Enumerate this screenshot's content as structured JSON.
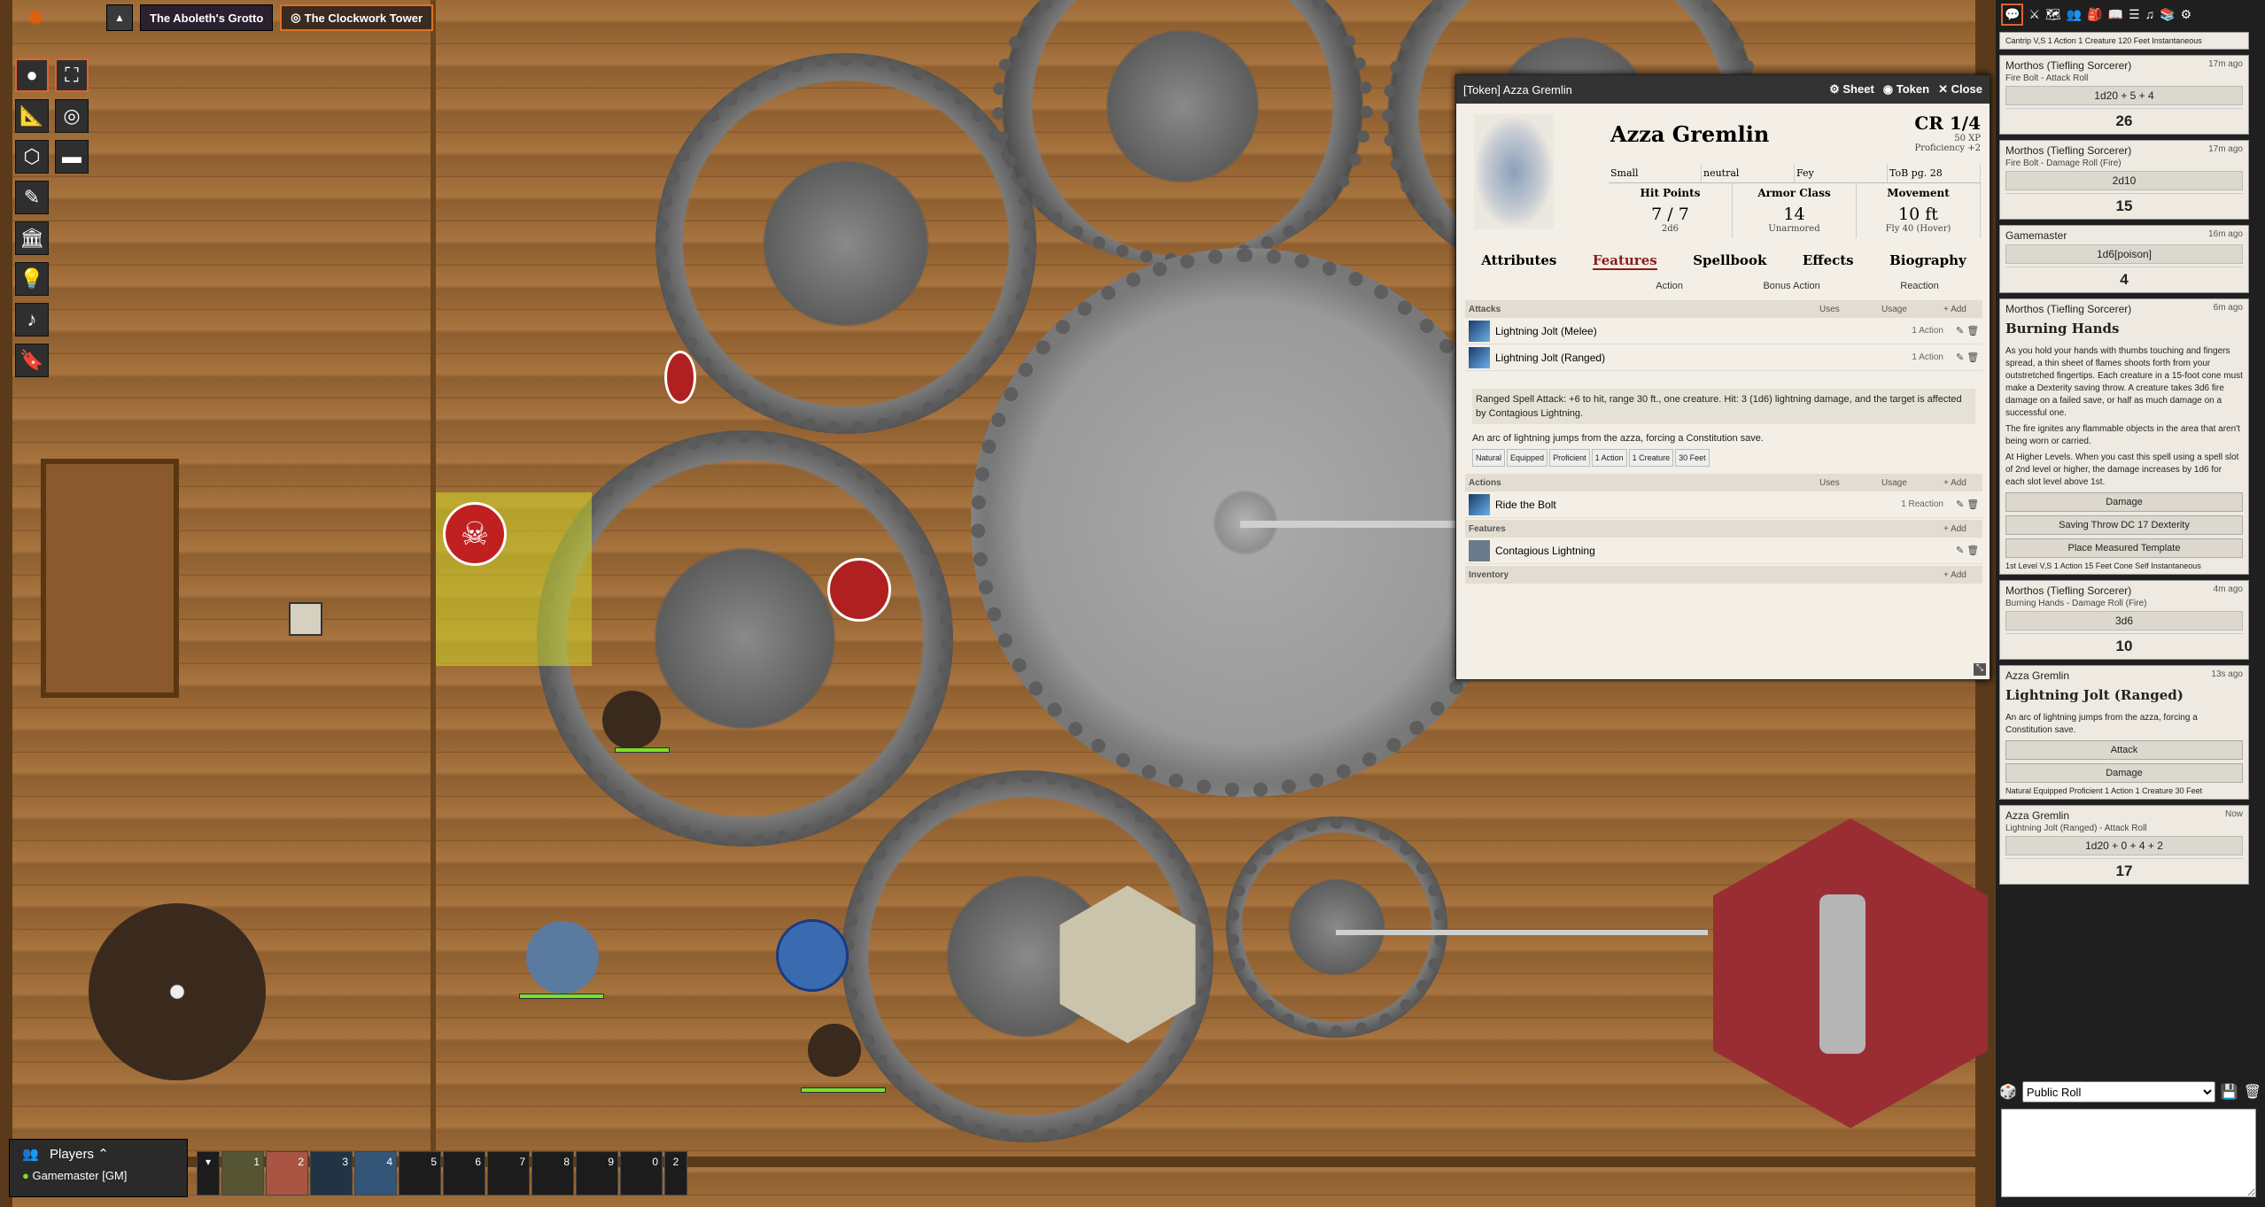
{
  "scenes": {
    "scene1": "The Aboleth's Grotto",
    "scene2": "The Clockwork Tower"
  },
  "players": {
    "header": "Players",
    "gm": "Gamemaster [GM]"
  },
  "hotbar": [
    "1",
    "2",
    "3",
    "4",
    "5",
    "6",
    "7",
    "8",
    "9",
    "0"
  ],
  "hotbar_page": "2",
  "sheet": {
    "window_title": "[Token] Azza Gremlin",
    "actions": {
      "sheet": "Sheet",
      "token": "Token",
      "close": "Close"
    },
    "name": "Azza Gremlin",
    "cr": "CR 1/4",
    "xp": "50 XP",
    "prof": "Proficiency +2",
    "tags": [
      "Small",
      "neutral",
      "Fey",
      "ToB pg. 28"
    ],
    "hp": {
      "label": "Hit Points",
      "value": "7",
      "max": "7",
      "formula": "2d6"
    },
    "ac": {
      "label": "Armor Class",
      "value": "14",
      "sub": "Unarmored"
    },
    "move": {
      "label": "Movement",
      "value": "10 ft",
      "sub": "Fly 40 (Hover)"
    },
    "tabs": [
      "Attributes",
      "Features",
      "Spellbook",
      "Effects",
      "Biography"
    ],
    "subtabs": [
      "Action",
      "Bonus Action",
      "Reaction"
    ],
    "attacks_hdr": "Attacks",
    "uses": "Uses",
    "usage": "Usage",
    "add": "+ Add",
    "attack1": "Lightning Jolt (Melee)",
    "attack1_use": "1 Action",
    "attack2": "Lightning Jolt (Ranged)",
    "attack2_use": "1 Action",
    "attack_desc": "Ranged Spell Attack: +6 to hit, range 30 ft., one creature. Hit: 3 (1d6) lightning damage, and the target is affected by Contagious Lightning.",
    "attack_desc2": "An arc of lightning jumps from the azza, forcing a Constitution save.",
    "attack_pills": [
      "Natural",
      "Equipped",
      "Proficient",
      "1 Action",
      "1 Creature",
      "30 Feet"
    ],
    "actions_hdr": "Actions",
    "action1": "Ride the Bolt",
    "action1_use": "1 Reaction",
    "features_hdr": "Features",
    "feature1": "Contagious Lightning",
    "inventory_hdr": "Inventory"
  },
  "chat": {
    "top_pills": "Cantrip  V,S  1 Action  1 Creature  120 Feet  Instantaneous",
    "c1": {
      "who": "Morthos (Tiefling Sorcerer)",
      "time": "17m ago",
      "flavor": "Fire Bolt - Attack Roll",
      "formula": "1d20 + 5 + 4",
      "result": "26"
    },
    "c2": {
      "who": "Morthos (Tiefling Sorcerer)",
      "time": "17m ago",
      "flavor": "Fire Bolt - Damage Roll (Fire)",
      "formula": "2d10",
      "result": "15"
    },
    "c3": {
      "who": "Gamemaster",
      "time": "16m ago",
      "formula": "1d6[poison]",
      "result": "4"
    },
    "c4": {
      "who": "Morthos (Tiefling Sorcerer)",
      "time": "6m ago",
      "title": "Burning Hands",
      "text1": "As you hold your hands with thumbs touching and fingers spread, a thin sheet of flames shoots forth from your outstretched fingertips. Each creature in a 15-foot cone must make a Dexterity saving throw. A creature takes 3d6 fire damage on a failed save, or half as much damage on a successful one.",
      "text2": "The fire ignites any flammable objects in the area that aren't being worn or carried.",
      "text3": "At Higher Levels. When you cast this spell using a spell slot of 2nd level or higher, the damage increases by 1d6 for each slot level above 1st.",
      "b1": "Damage",
      "b2": "Saving Throw DC 17 Dexterity",
      "b3": "Place Measured Template",
      "pills": "1st Level  V,S  1 Action  15 Feet Cone  Self  Instantaneous"
    },
    "c5": {
      "who": "Morthos (Tiefling Sorcerer)",
      "time": "4m ago",
      "flavor": "Burning Hands - Damage Roll (Fire)",
      "formula": "3d6",
      "result": "10"
    },
    "c6": {
      "who": "Azza Gremlin",
      "time": "13s ago",
      "title": "Lightning Jolt (Ranged)",
      "text": "An arc of lightning jumps from the azza, forcing a Constitution save.",
      "b1": "Attack",
      "b2": "Damage",
      "pills": "Natural  Equipped  Proficient  1 Action  1 Creature  30 Feet"
    },
    "c7": {
      "who": "Azza Gremlin",
      "time": "Now",
      "flavor": "Lightning Jolt (Ranged) - Attack Roll",
      "formula": "1d20 + 0 + 4 + 2",
      "result": "17"
    },
    "roll_mode": "Public Roll"
  },
  "colors": {
    "accent": "#e06030",
    "wood": "#9c6a36",
    "rug": "#9a2d33"
  }
}
